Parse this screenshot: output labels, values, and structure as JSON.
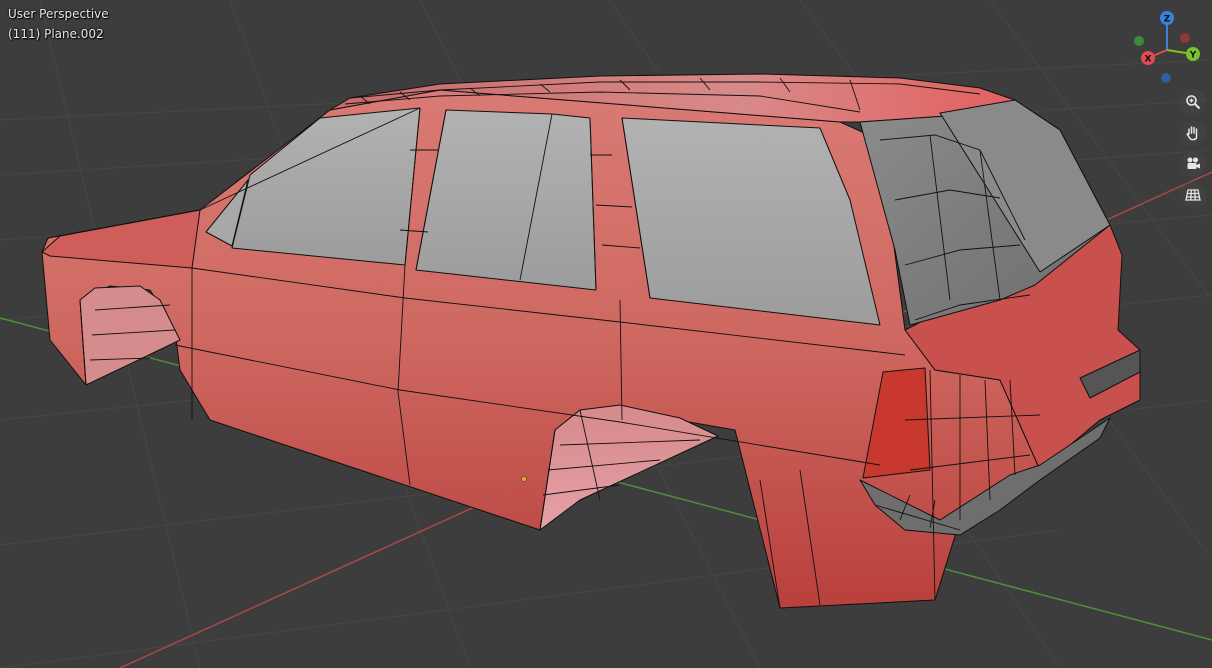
{
  "viewport": {
    "view_name": "User Perspective",
    "object_info": "(111) Plane.002"
  },
  "gizmo": {
    "z_label": "Z",
    "y_label": "Y",
    "x_label": "X",
    "colors": {
      "x": "#e04b55",
      "y": "#77c22e",
      "z": "#3a82e0",
      "neg_x": "#8f3a3a",
      "neg_y": "#3e8a3a",
      "neg_z": "#2d5fa3"
    }
  },
  "nav": [
    {
      "name": "zoom",
      "icon": "zoom-icon"
    },
    {
      "name": "pan",
      "icon": "hand-icon"
    },
    {
      "name": "camera",
      "icon": "camera-icon"
    },
    {
      "name": "ortho",
      "icon": "grid-icon"
    }
  ],
  "colors": {
    "background": "#3d3d3d",
    "body": "#c94f4c",
    "glass": "#a4a4a4",
    "wire": "#111111",
    "x_axis": "#a84848",
    "y_axis": "#4e8f3a"
  }
}
